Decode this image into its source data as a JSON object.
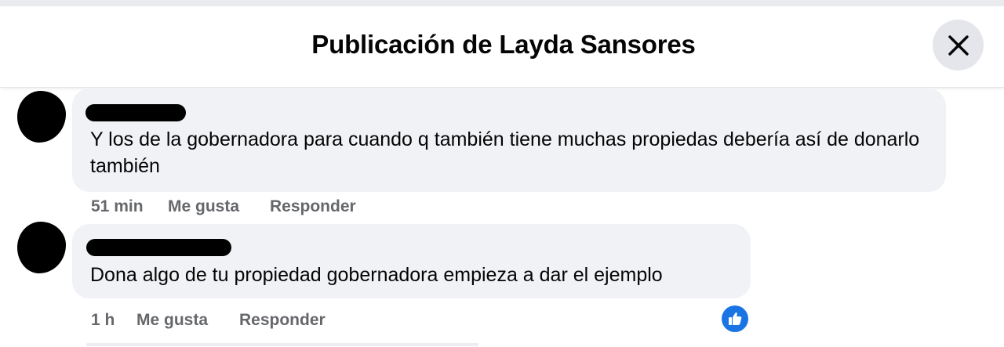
{
  "dialog": {
    "title": "Publicación de Layda Sansores",
    "close_icon": "close-icon"
  },
  "comments": [
    {
      "text": "Y los de la gobernadora para cuando q también tiene muchas propiedas debería así de donarlo también",
      "time": "51 min",
      "like_label": "Me gusta",
      "reply_label": "Responder"
    },
    {
      "text": "Dona algo de tu propiedad gobernadora empieza a dar el ejemplo",
      "time": "1 h",
      "like_label": "Me gusta",
      "reply_label": "Responder",
      "reaction_icon": "like-reaction-icon"
    }
  ],
  "colors": {
    "bubble": "#f0f2f5",
    "action_text": "#65676b",
    "like_blue": "#1b74e4",
    "close_bg": "#e4e6eb"
  }
}
